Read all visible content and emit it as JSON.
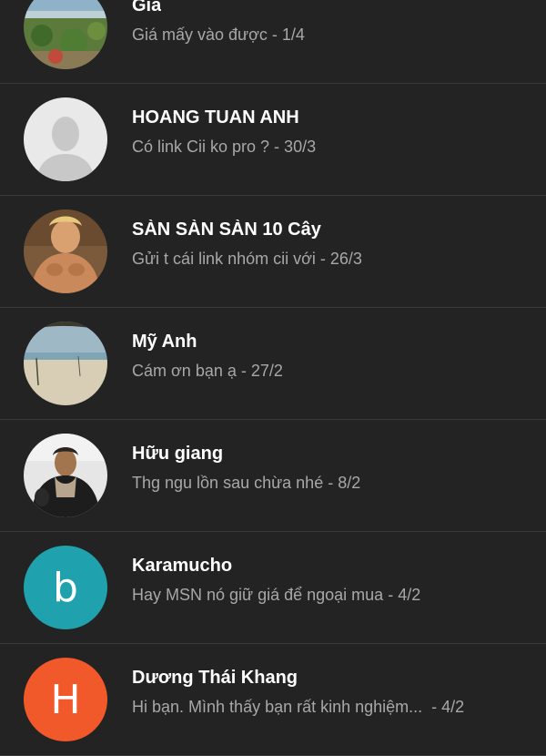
{
  "conversations": [
    {
      "name": "Gia",
      "preview": "Giá mấy vào được - 1/4",
      "avatar": {
        "type": "photo",
        "icon": "beach-photo-avatar"
      }
    },
    {
      "name": "HOANG TUAN ANH",
      "preview": "Có link Cii ko pro ? - 30/3",
      "avatar": {
        "type": "photo",
        "icon": "default-person-avatar"
      }
    },
    {
      "name": "SÀN SÀN SÀN 10 Cây",
      "preview": "Gửi t cái link nhóm cii với - 26/3",
      "avatar": {
        "type": "photo",
        "icon": "muscular-man-photo-avatar"
      }
    },
    {
      "name": "Mỹ Anh",
      "preview": "Cám ơn bạn ạ - 27/2",
      "avatar": {
        "type": "photo",
        "icon": "beach-photo-avatar"
      }
    },
    {
      "name": "Hữu giang",
      "preview": "Thg ngu lồn sau chừa nhé - 8/2",
      "avatar": {
        "type": "photo",
        "icon": "man-with-scarf-photo-avatar"
      }
    },
    {
      "name": "Karamucho",
      "preview": "Hay MSN nó giữ giá để ngoại mua - 4/2",
      "avatar": {
        "type": "letter",
        "letter": "b",
        "color": "#1fa2ae"
      }
    },
    {
      "name": "Dương Thái Khang",
      "preview": "Hi bạn. Mình thấy bạn rất kinh nghiệm...  - 4/2",
      "avatar": {
        "type": "letter",
        "letter": "H",
        "color": "#f1592a"
      }
    }
  ],
  "colors": {
    "background": "#232323",
    "name_text": "#ffffff",
    "preview_text": "#a8a8a8",
    "divider": "#3a3a3a"
  }
}
